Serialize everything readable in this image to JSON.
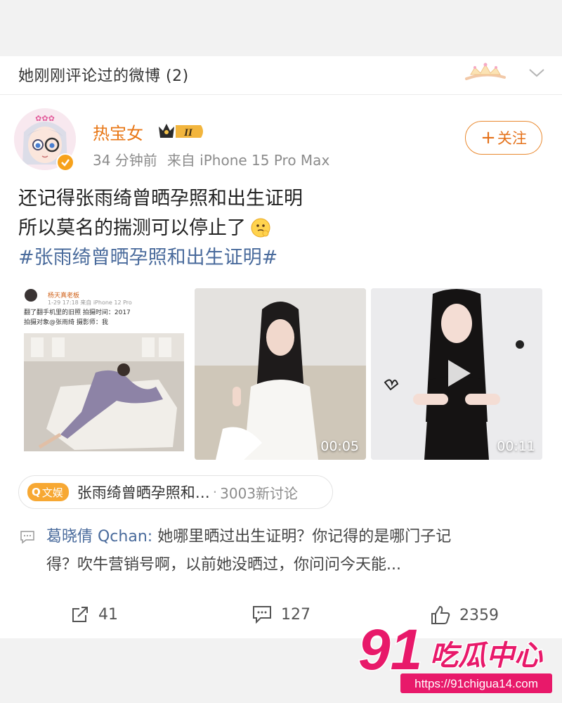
{
  "section": {
    "title": "她刚刚评论过的微博 (2)"
  },
  "post": {
    "author": "热宝女",
    "level_badge": "II",
    "time": "34 分钟前",
    "source": "来自 iPhone 15 Pro Max",
    "follow_label": "关注",
    "text_line1": "还记得张雨绮曾晒孕照和出生证明",
    "text_line2": "所以莫名的揣测可以停止了",
    "hashtag": "#张雨绮曾晒孕照和出生证明#",
    "media": [
      {
        "type": "screenshot",
        "name": "杨天真老板",
        "time": "1-29 17:18  来自 iPhone 12 Pro",
        "caption1": "翻了翻手机里的旧照  拍摄时间：2017",
        "caption2": "拍摄对象@张雨绮  摄影师：我"
      },
      {
        "type": "video",
        "duration": "00:05"
      },
      {
        "type": "video",
        "duration": "00:11"
      }
    ],
    "topic": {
      "tag": "文娱",
      "title": "张雨绮曾晒孕照和…",
      "count": "3003新讨论"
    },
    "comment_preview": {
      "user": "葛晓倩 Qchan:",
      "text_line1": "她哪里晒过出生证明？你记得的是哪门子记",
      "text_line2": "得？吹牛营销号啊，以前她没晒过，你问问今天能..."
    },
    "actions": {
      "reposts": "41",
      "comments": "127",
      "likes": "2359"
    }
  },
  "watermark": {
    "brand_digits": "91",
    "brand_text": "吃瓜中心",
    "url": "https://91chigua14.com"
  },
  "colors": {
    "accent_orange": "#e4711a",
    "link_blue": "#4a6b9c",
    "watermark_pink": "#e8196a",
    "background": "#f2f2f2"
  }
}
